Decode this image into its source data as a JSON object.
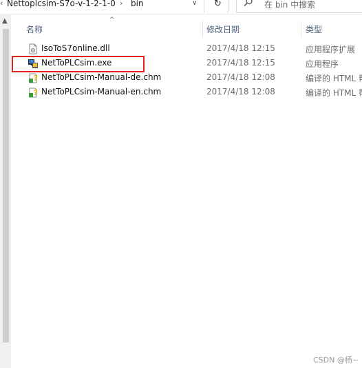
{
  "address": {
    "crumbs": [
      "Nettoplcsim-S7o-v-1-2-1-0",
      "bin"
    ],
    "separator": "›",
    "dropdown": "∨",
    "left_fragment": "‹"
  },
  "refresh_icon": "↻",
  "search": {
    "placeholder": "在 bin 中搜索",
    "icon": "search-icon"
  },
  "columns": {
    "name": "名称",
    "modified": "修改日期",
    "type": "类型",
    "sort_indicator": "^"
  },
  "files": [
    {
      "name": "IsoToS7online.dll",
      "modified": "2017/4/18 12:15",
      "type": "应用程序扩展",
      "icon": "dll-file-icon"
    },
    {
      "name": "NetToPLCsim.exe",
      "modified": "2017/4/18 12:15",
      "type": "应用程序",
      "icon": "exe-app-icon",
      "highlighted": true
    },
    {
      "name": "NetToPLCsim-Manual-de.chm",
      "modified": "2017/4/18 12:08",
      "type": "编译的 HTML 帮",
      "icon": "chm-help-icon"
    },
    {
      "name": "NetToPLCsim-Manual-en.chm",
      "modified": "2017/4/18 12:08",
      "type": "编译的 HTML 帮",
      "icon": "chm-help-icon"
    }
  ],
  "highlight_color": "#e02020",
  "watermark": "CSDN @杨~"
}
